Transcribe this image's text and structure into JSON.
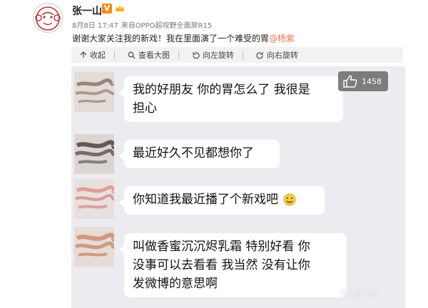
{
  "post": {
    "username": "张一山",
    "vip_badge": "V",
    "date": "8月8日 17:47",
    "source_prefix": "来自",
    "source": "OPPO超视野全面屏R15",
    "text_main": "谢谢大家关注我的新戏！我在里面演了一个难受的胃",
    "mention": "@杨紫",
    "colors": {
      "mention": "#eb7350",
      "vip": "#f08b1c"
    }
  },
  "actions": {
    "collapse": "收起",
    "view_large": "查看大图",
    "rotate_left": "向左旋转",
    "rotate_right": "向右旋转"
  },
  "like": {
    "count": "1458"
  },
  "chat": {
    "messages": [
      {
        "line1": "我的好朋友 你的胃怎么了 我很是",
        "line2": "担心"
      },
      {
        "text": "最近好久不见都想你了"
      },
      {
        "text": "你知道我最近播了个新戏吧",
        "emoji": "smile"
      },
      {
        "line1": "叫做香蜜沉沉烬乳霜 特别好看 你",
        "line2": "没事可以去看看 我当然 没有让你",
        "line3": "发微博的意思啊"
      }
    ]
  },
  "watermark": "号/热门电"
}
